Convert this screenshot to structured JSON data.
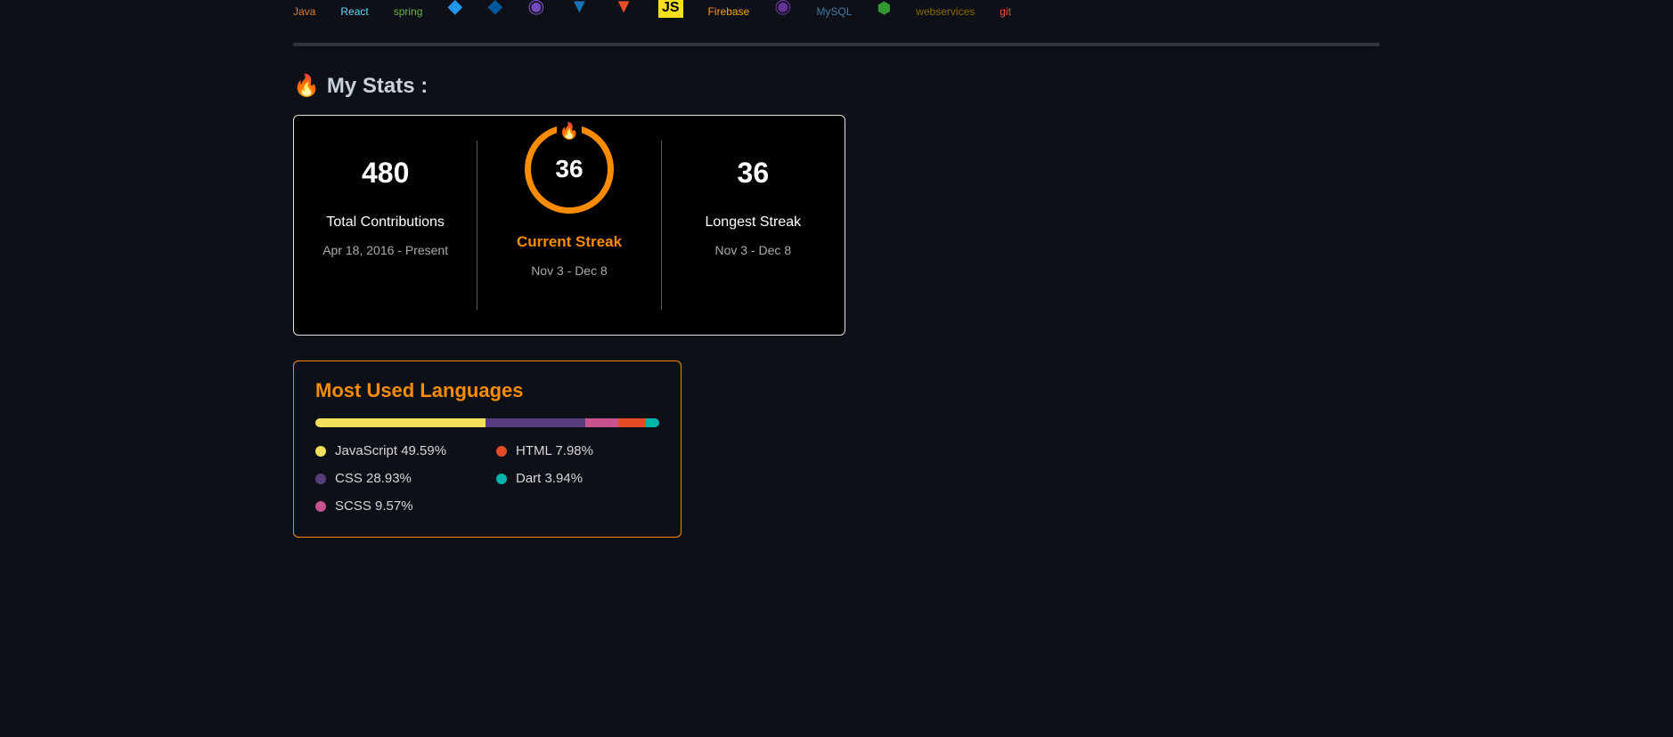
{
  "tech": {
    "java": "Java",
    "react": "React",
    "spring": "spring",
    "firebase": "Firebase",
    "mysql": "MySQL",
    "aws": "webservices",
    "git": "git",
    "js_badge": "JS"
  },
  "heading": {
    "icon": "🔥",
    "text": "My Stats :"
  },
  "streak": {
    "total": {
      "value": "480",
      "label": "Total Contributions",
      "sub": "Apr 18, 2016 - Present"
    },
    "current": {
      "value": "36",
      "label": "Current Streak",
      "sub": "Nov 3 - Dec 8",
      "fire": "🔥"
    },
    "longest": {
      "value": "36",
      "label": "Longest Streak",
      "sub": "Nov 3 - Dec 8"
    }
  },
  "languages": {
    "title": "Most Used Languages",
    "items": [
      {
        "name": "JavaScript",
        "pct": "49.59%",
        "color": "#f1e05a"
      },
      {
        "name": "CSS",
        "pct": "28.93%",
        "color": "#563d7c"
      },
      {
        "name": "SCSS",
        "pct": "9.57%",
        "color": "#c6538c"
      },
      {
        "name": "HTML",
        "pct": "7.98%",
        "color": "#e34c26"
      },
      {
        "name": "Dart",
        "pct": "3.94%",
        "color": "#00b4ab"
      }
    ]
  },
  "chart_data": {
    "type": "bar",
    "title": "Most Used Languages",
    "categories": [
      "JavaScript",
      "CSS",
      "SCSS",
      "HTML",
      "Dart"
    ],
    "values": [
      49.59,
      28.93,
      9.57,
      7.98,
      3.94
    ],
    "series": [
      {
        "name": "JavaScript",
        "values": [
          49.59
        ],
        "color": "#f1e05a"
      },
      {
        "name": "CSS",
        "values": [
          28.93
        ],
        "color": "#563d7c"
      },
      {
        "name": "SCSS",
        "values": [
          9.57
        ],
        "color": "#c6538c"
      },
      {
        "name": "HTML",
        "values": [
          7.98
        ],
        "color": "#e34c26"
      },
      {
        "name": "Dart",
        "values": [
          3.94
        ],
        "color": "#00b4ab"
      }
    ],
    "xlabel": "",
    "ylabel": "",
    "ylim": [
      0,
      100
    ]
  }
}
